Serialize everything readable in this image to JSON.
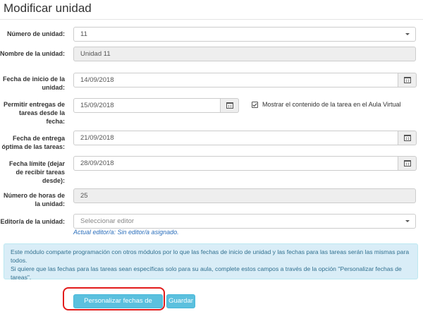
{
  "page": {
    "title": "Modificar unidad"
  },
  "form": {
    "numero_unidad": {
      "label": "Número de unidad:",
      "value": "11"
    },
    "nombre_unidad": {
      "label": "Nombre de la unidad:",
      "value": "Unidad 11"
    },
    "fecha_inicio": {
      "label": "Fecha de inicio de la unidad:",
      "value": "14/09/2018",
      "icon": "calendar-icon"
    },
    "permitir_entregas": {
      "label": "Permitir entregas de tareas desde la fecha:",
      "value": "15/09/2018",
      "icon": "calendar-icon"
    },
    "mostrar_contenido": {
      "label": "Mostrar el contenido de la tarea en el Aula Virtual",
      "checked": true
    },
    "fecha_entrega_optima": {
      "label": "Fecha de entrega óptima de las tareas:",
      "value": "21/09/2018",
      "icon": "calendar-icon"
    },
    "fecha_limite": {
      "label": "Fecha límite (dejar de recibir tareas desde):",
      "value": "28/09/2018",
      "icon": "calendar-icon"
    },
    "numero_horas": {
      "label": "Número de horas de la unidad:",
      "value": "25"
    },
    "editor": {
      "label": "Editor/a de la unidad:",
      "placeholder": "Seleccionar editor",
      "hint": "Actual editor/a: Sin editor/a asignado."
    }
  },
  "info_box": {
    "line1": "Este módulo comparte programación con otros módulos por lo que las fechas de inicio de unidad y las fechas para las tareas serán las mismas para todos.",
    "line2": "Si quiere que las fechas para las tareas sean específicas solo para su aula, complete estos campos a través de la opción \"Personalizar fechas de tareas\"."
  },
  "buttons": {
    "personalizar": "Personalizar fechas de tareas",
    "guardar": "Guardar"
  },
  "colors": {
    "info_bg": "#d9edf7",
    "info_text": "#31708f",
    "button_bg": "#5bc0de",
    "highlight": "#e21b1b",
    "hint_text": "#2a6ebb"
  }
}
